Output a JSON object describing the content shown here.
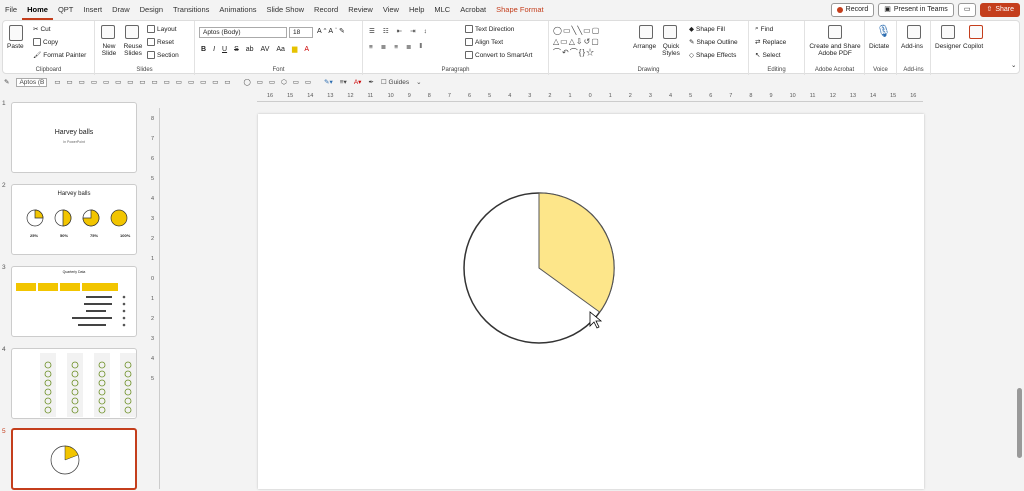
{
  "menu": {
    "tabs": [
      "File",
      "Home",
      "QPT",
      "Insert",
      "Draw",
      "Design",
      "Transitions",
      "Animations",
      "Slide Show",
      "Record",
      "Review",
      "View",
      "Help",
      "MLC",
      "Acrobat",
      "Shape Format"
    ],
    "record_btn": "Record",
    "present_btn": "Present in Teams",
    "share_btn": "Share"
  },
  "ribbon": {
    "clipboard": {
      "paste": "Paste",
      "cut": "Cut",
      "copy": "Copy",
      "format_painter": "Format Painter",
      "label": "Clipboard"
    },
    "slides": {
      "new_slide": "New Slide",
      "reuse": "Reuse Slides",
      "layout": "Layout",
      "reset": "Reset",
      "section": "Section",
      "label": "Slides"
    },
    "font": {
      "name": "Aptos (Body)",
      "size": "18",
      "label": "Font"
    },
    "paragraph": {
      "text_direction": "Text Direction",
      "align_text": "Align Text",
      "convert": "Convert to SmartArt",
      "label": "Paragraph"
    },
    "drawing": {
      "arrange": "Arrange",
      "quick_styles": "Quick Styles",
      "shape_fill": "Shape Fill",
      "shape_outline": "Shape Outline",
      "shape_effects": "Shape Effects",
      "label": "Drawing"
    },
    "editing": {
      "find": "Find",
      "replace": "Replace",
      "select": "Select",
      "label": "Editing"
    },
    "acrobat": {
      "create": "Create and Share Adobe PDF",
      "label": "Adobe Acrobat"
    },
    "voice": {
      "dictate": "Dictate",
      "label": "Voice"
    },
    "addins": {
      "addins": "Add-ins",
      "label": "Add-ins"
    },
    "designer": "Designer",
    "copilot": "Copilot"
  },
  "toolbar2": {
    "font": "Aptos (B",
    "guides": "Guides"
  },
  "ruler": [
    "16",
    "15",
    "14",
    "13",
    "12",
    "11",
    "10",
    "9",
    "8",
    "7",
    "6",
    "5",
    "4",
    "3",
    "2",
    "1",
    "0",
    "1",
    "2",
    "3",
    "4",
    "5",
    "6",
    "7",
    "8",
    "9",
    "10",
    "11",
    "12",
    "13",
    "14",
    "15",
    "16"
  ],
  "vruler": [
    "8",
    "7",
    "6",
    "5",
    "4",
    "3",
    "2",
    "1",
    "0",
    "1",
    "2",
    "3",
    "4",
    "5"
  ],
  "slides": [
    {
      "num": "1",
      "title": "Harvey balls",
      "subtitle": "In PowerPoint"
    },
    {
      "num": "2",
      "title": "Harvey balls",
      "labels": [
        "25%",
        "50%",
        "75%",
        "100%"
      ]
    },
    {
      "num": "3",
      "title": "Quarterly Data"
    },
    {
      "num": "4"
    },
    {
      "num": "5"
    }
  ],
  "canvas": {
    "pie_fill_fraction": 0.35,
    "fill_color": "#fde68a",
    "accent": "#c43e1c"
  }
}
